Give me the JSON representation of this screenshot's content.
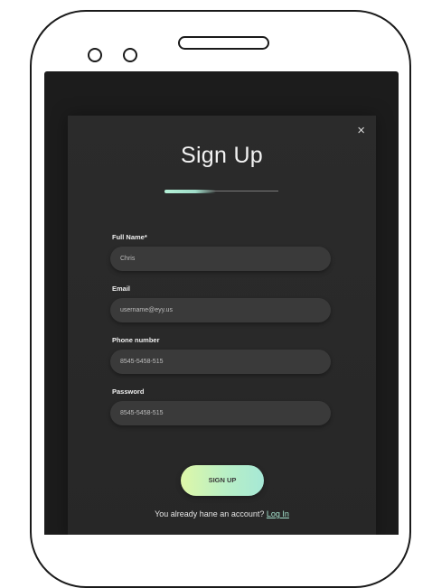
{
  "modal": {
    "close_icon": "×",
    "title": "Sign Up",
    "progress": 0.45,
    "accent": "#b5f2d8"
  },
  "form": {
    "full_name": {
      "label": "Full Name*",
      "value": "Chris"
    },
    "email": {
      "label": "Email",
      "value": "username@eyy.us"
    },
    "phone": {
      "label": "Phone number",
      "value": "8545-5458-515"
    },
    "password": {
      "label": "Password",
      "value": "8545-5458-515"
    }
  },
  "signup_button": {
    "label": "SIGN UP"
  },
  "footer": {
    "prompt": "You already hane an account?",
    "login_link": "Log In"
  }
}
